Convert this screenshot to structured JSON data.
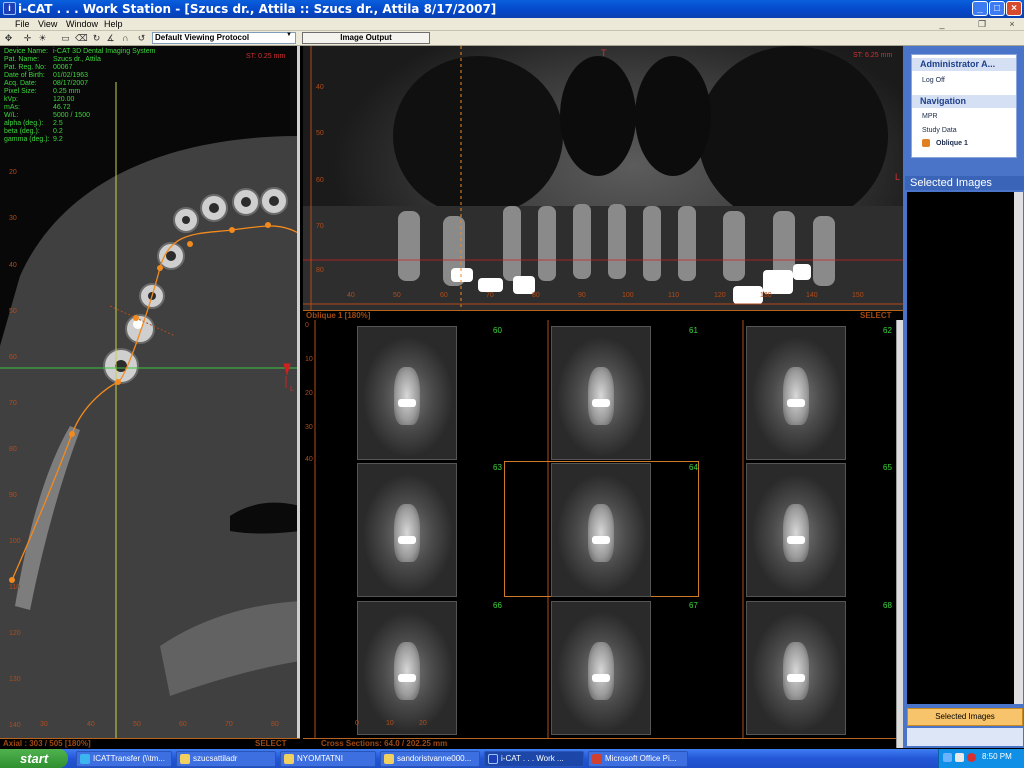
{
  "window": {
    "title": "i-CAT  . . .  Work Station - [Szucs dr., Attila :: Szucs dr., Attila 8/17/2007]",
    "app_icon_letter": "i"
  },
  "menu": [
    "File",
    "View",
    "Window",
    "Help"
  ],
  "toolbar": {
    "protocol_value": "Default Viewing Protocol",
    "image_output_label": "Image Output"
  },
  "axial": {
    "info_labels": [
      "Device Name:",
      "Pat. Name:",
      "Pat. Reg. No:",
      "Date of Birth:",
      "Acq. Date:",
      "Pixel Size:",
      "kVp:",
      "mAs:",
      "W/L:",
      "alpha (deg.):",
      "beta (deg.):",
      "gamma (deg.):"
    ],
    "info_values": [
      "i-CAT 3D Dental Imaging System",
      "Szucs dr., Attila",
      "00067",
      "01/02/1963",
      "08/17/2007",
      "0.25 mm",
      "120.00",
      "46.72",
      "5000 / 1500",
      "2.5",
      "0.2",
      "9.2"
    ],
    "slice_thickness": "ST: 0.25 mm",
    "left_ruler": [
      "20",
      "30",
      "40",
      "50",
      "60",
      "70",
      "80",
      "90",
      "100",
      "110",
      "120",
      "130",
      "140"
    ],
    "bottom_ruler": [
      "30",
      "40",
      "50",
      "60",
      "70",
      "80"
    ],
    "orientation_letter": "L",
    "footer_left": "Axial : 303 / 505 [180%]",
    "footer_right": "SELECT"
  },
  "pano": {
    "slice_thickness": "ST: 6.25 mm",
    "top_letter": "T",
    "right_letter": "L",
    "left_ruler": [
      "40",
      "50",
      "60",
      "70",
      "80"
    ],
    "bottom_ruler": [
      "40",
      "50",
      "60",
      "70",
      "80",
      "90",
      "100",
      "110",
      "120",
      "130",
      "140",
      "150"
    ],
    "footer_left": "Oblique 1 [180%]",
    "footer_right": "SELECT"
  },
  "cross_sections": {
    "numbers": [
      "60",
      "61",
      "62",
      "63",
      "64",
      "65",
      "66",
      "67",
      "68"
    ],
    "left_ruler": [
      "0",
      "10",
      "20",
      "30",
      "40"
    ],
    "bottom_ruler": [
      "0",
      "10",
      "20"
    ],
    "footer_left": "Cross Sections: 64.0 / 202.25 mm"
  },
  "sidebar": {
    "admin_title": "Administrator A...",
    "log_off": "Log Off",
    "navigation_title": "Navigation",
    "nav_items": [
      "MPR",
      "Study Data",
      "Oblique 1"
    ],
    "selected_images_title": "Selected Images",
    "selected_images_button": "Selected Images"
  },
  "taskbar": {
    "start_label": "start",
    "tasks": [
      "ICATTransfer (\\\\tm...",
      "szucsattiladr",
      "NYOMTATNI",
      "sandoristvanne000...",
      "i-CAT  . . .  Work ...",
      "Microsoft Office Pi..."
    ],
    "clock": "8:50 PM"
  },
  "colors": {
    "overlay_green": "#3cd63c",
    "ruler_orange": "#b24b18",
    "curve_orange": "#f28a1e",
    "xp_blue": "#0347c9"
  }
}
